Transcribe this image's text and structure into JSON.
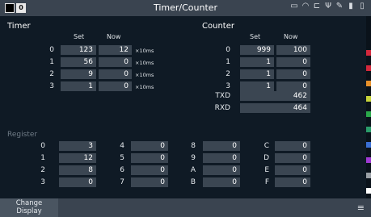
{
  "window": {
    "title": "Timer/Counter",
    "badge": "0"
  },
  "timer": {
    "title": "Timer",
    "set_label": "Set",
    "now_label": "Now",
    "rows": [
      {
        "index": "0",
        "set": "123",
        "now": "12",
        "unit": "×10ms"
      },
      {
        "index": "1",
        "set": "56",
        "now": "0",
        "unit": "×10ms"
      },
      {
        "index": "2",
        "set": "9",
        "now": "0",
        "unit": "×10ms"
      },
      {
        "index": "3",
        "set": "1",
        "now": "0",
        "unit": "×10ms"
      }
    ]
  },
  "counter": {
    "title": "Counter",
    "set_label": "Set",
    "now_label": "Now",
    "rows": [
      {
        "index": "0",
        "set": "999",
        "now": "100"
      },
      {
        "index": "1",
        "set": "1",
        "now": "0"
      },
      {
        "index": "2",
        "set": "1",
        "now": "0"
      },
      {
        "index": "3",
        "set": "1",
        "now": "0"
      }
    ],
    "txd_label": "TXD",
    "txd_value": "462",
    "rxd_label": "RXD",
    "rxd_value": "464"
  },
  "register": {
    "title": "Register",
    "cells": [
      {
        "label": "0",
        "value": "3"
      },
      {
        "label": "4",
        "value": "0"
      },
      {
        "label": "8",
        "value": "0"
      },
      {
        "label": "C",
        "value": "0"
      },
      {
        "label": "1",
        "value": "12"
      },
      {
        "label": "5",
        "value": "0"
      },
      {
        "label": "9",
        "value": "0"
      },
      {
        "label": "D",
        "value": "0"
      },
      {
        "label": "2",
        "value": "8"
      },
      {
        "label": "6",
        "value": "0"
      },
      {
        "label": "A",
        "value": "0"
      },
      {
        "label": "E",
        "value": "0"
      },
      {
        "label": "3",
        "value": "0"
      },
      {
        "label": "7",
        "value": "0"
      },
      {
        "label": "B",
        "value": "0"
      },
      {
        "label": "F",
        "value": "0"
      }
    ]
  },
  "bottom": {
    "change_display": "Change\nDisplay"
  },
  "status_icons": [
    "printer-icon",
    "wifi-icon",
    "network-icon",
    "usb-icon",
    "edit-icon",
    "sd-card-icon",
    "battery-icon"
  ],
  "side_tab_colors": [
    "#d4283c",
    "#d4283c",
    "#e8912a",
    "#c7d43a",
    "#2aa84a",
    "#2a9c6a",
    "#3a6fd4",
    "#a03ad4",
    "#9aa0a6",
    "#ffffff"
  ]
}
